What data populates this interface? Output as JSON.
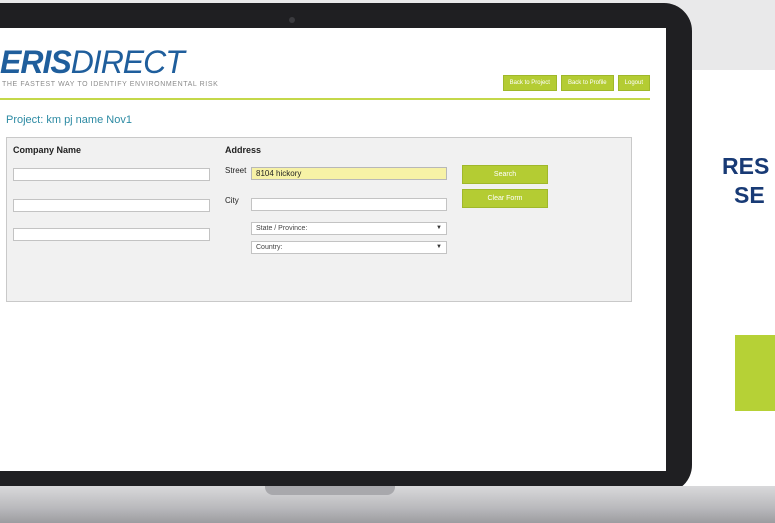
{
  "app": {
    "logo_part1": "ERIS",
    "logo_part2": "DIRECT",
    "tagline": "THE FASTEST WAY TO IDENTIFY ENVIRONMENTAL RISK"
  },
  "header": {
    "buttons": [
      "Back to Project",
      "Back to Profile",
      "Logout"
    ]
  },
  "project": {
    "title": "Project: km pj name Nov1"
  },
  "form": {
    "company_header": "Company Name",
    "address_header": "Address",
    "company_fields": [
      "",
      "",
      ""
    ],
    "street_label": "Street",
    "street_value": "8104 hickory",
    "city_label": "City",
    "city_value": "",
    "state_select": "State / Province:",
    "country_select": "Country:",
    "search_button": "Search",
    "clear_button": "Clear Form"
  },
  "side": {
    "heading_line1": "RES",
    "heading_line2": "SE"
  },
  "colors": {
    "accent_green": "#b4cc33",
    "brand_blue": "#1f5e9c",
    "project_teal": "#2c8aa3",
    "side_navy": "#183a75"
  }
}
